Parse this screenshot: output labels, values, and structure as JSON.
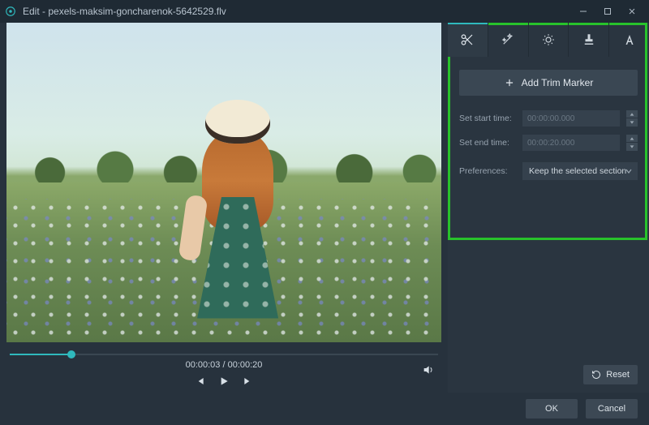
{
  "titlebar": {
    "title": "Edit - pexels-maksim-goncharenok-5642529.flv"
  },
  "player": {
    "current_time": "00:00:03",
    "duration": "00:00:20",
    "time_display": "00:00:03 / 00:00:20",
    "progress_percent": 15
  },
  "tabs": {
    "names": [
      "cut",
      "effects",
      "brightness",
      "watermark",
      "text"
    ]
  },
  "trim_panel": {
    "add_marker_label": "Add Trim Marker",
    "start_label": "Set start time:",
    "start_value": "00:00:00.000",
    "end_label": "Set end time:",
    "end_value": "00:00:20.000",
    "preferences_label": "Preferences:",
    "preferences_value": "Keep the selected section"
  },
  "buttons": {
    "reset": "Reset",
    "ok": "OK",
    "cancel": "Cancel"
  }
}
